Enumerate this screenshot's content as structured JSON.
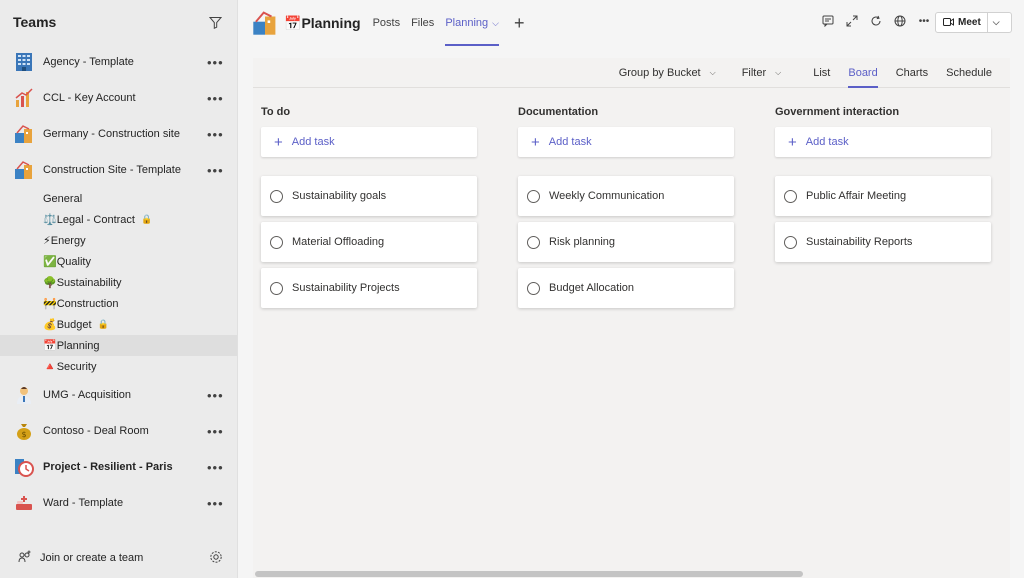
{
  "sidebar": {
    "title": "Teams",
    "teams": [
      {
        "name": "Agency - Template",
        "icon": "building-icon"
      },
      {
        "name": "CCL - Key Account",
        "icon": "chart-icon"
      },
      {
        "name": "Germany - Construction site",
        "icon": "construction-icon"
      },
      {
        "name": "Construction Site - Template",
        "icon": "construction-icon"
      }
    ],
    "channels": [
      {
        "label": "General",
        "emoji": ""
      },
      {
        "label": "Legal - Contract",
        "emoji": "⚖️",
        "locked": true
      },
      {
        "label": "Energy",
        "emoji": "⚡"
      },
      {
        "label": "Quality",
        "emoji": "✅"
      },
      {
        "label": "Sustainability",
        "emoji": "🌳"
      },
      {
        "label": "Construction",
        "emoji": "🚧"
      },
      {
        "label": "Budget",
        "emoji": "💰",
        "locked": true
      },
      {
        "label": "Planning",
        "emoji": "📅"
      },
      {
        "label": "Security",
        "emoji": "🔺"
      }
    ],
    "more_teams": [
      {
        "name": "UMG - Acquisition",
        "icon": "person-icon"
      },
      {
        "name": "Contoso - Deal Room",
        "icon": "money-bag-icon"
      },
      {
        "name": "Project - Resilient - Paris",
        "icon": "clock-icon",
        "bold": true
      },
      {
        "name": "Ward - Template",
        "icon": "medical-icon"
      }
    ],
    "footer_label": "Join or create a team",
    "more_glyph": "•••",
    "lock_glyph": "🔒"
  },
  "topbar": {
    "title_emoji": "📅",
    "title": "Planning",
    "tabs": [
      "Posts",
      "Files",
      "Planning"
    ],
    "active_tab_caret": "⌵",
    "add_tab_glyph": "+",
    "meet_label": "Meet",
    "more_glyph": "•••"
  },
  "planner": {
    "toolbar": {
      "group_by": "Group by Bucket",
      "filter": "Filter",
      "views": [
        "List",
        "Board",
        "Charts",
        "Schedule"
      ],
      "active_view": "Board"
    },
    "add_task_label": "Add task",
    "buckets": [
      {
        "title": "To do",
        "tasks": [
          "Sustainability goals",
          "Material Offloading",
          "Sustainability Projects"
        ]
      },
      {
        "title": "Documentation",
        "tasks": [
          "Weekly Communication",
          "Risk planning",
          "Budget Allocation"
        ]
      },
      {
        "title": "Government interaction",
        "tasks": [
          "Public Affair Meeting",
          "Sustainability Reports"
        ]
      }
    ]
  },
  "colors": {
    "accent": "#5b5fc7",
    "sidebar_bg": "#ebebeb",
    "pane_bg": "#f3f2f1"
  }
}
